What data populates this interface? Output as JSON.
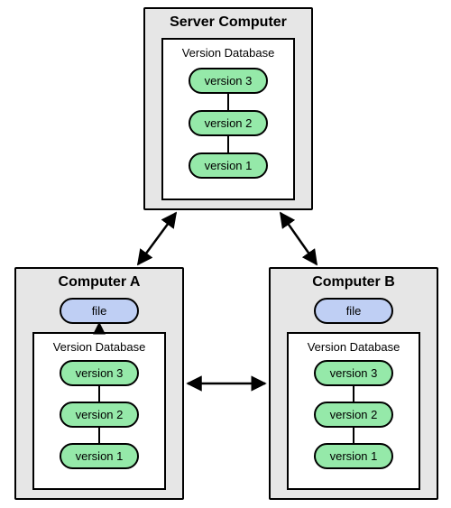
{
  "server": {
    "title": "Server Computer",
    "db_title": "Version Database",
    "versions": {
      "v3": "version 3",
      "v2": "version 2",
      "v1": "version 1"
    }
  },
  "clientA": {
    "title": "Computer A",
    "file_label": "file",
    "db_title": "Version Database",
    "versions": {
      "v3": "version 3",
      "v2": "version 2",
      "v1": "version 1"
    }
  },
  "clientB": {
    "title": "Computer B",
    "file_label": "file",
    "db_title": "Version Database",
    "versions": {
      "v3": "version 3",
      "v2": "version 2",
      "v1": "version 1"
    }
  }
}
